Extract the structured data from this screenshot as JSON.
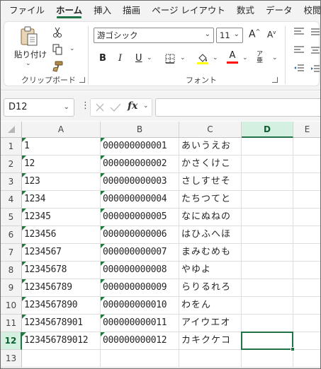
{
  "menu": {
    "tabs": [
      "ファイル",
      "ホーム",
      "挿入",
      "描画",
      "ページ レイアウト",
      "数式",
      "データ",
      "校閲"
    ],
    "active_index": 1
  },
  "ribbon": {
    "clipboard": {
      "group_label": "クリップボード",
      "paste_label": "貼り付け"
    },
    "font": {
      "group_label": "フォント",
      "font_name": "游ゴシック",
      "font_size": "11",
      "increase_label": "A",
      "decrease_label": "A",
      "bold_label": "B",
      "italic_label": "I",
      "underline_label": "U",
      "font_color_label": "A",
      "phonetic_label": "ア亜",
      "fill_color": "#ffff00",
      "font_color": "#ff0000"
    }
  },
  "formula_bar": {
    "name_box": "D12",
    "fx_label": "fx",
    "formula": ""
  },
  "sheet": {
    "columns": [
      "A",
      "B",
      "C",
      "D",
      "E"
    ],
    "selected_column": "D",
    "selected_row": 12,
    "rows": [
      {
        "num": "1",
        "a": "1",
        "b": "000000000001",
        "c": "あいうえお"
      },
      {
        "num": "2",
        "a": "12",
        "b": "000000000002",
        "c": "かさくけこ"
      },
      {
        "num": "3",
        "a": "123",
        "b": "000000000003",
        "c": "さしすせそ"
      },
      {
        "num": "4",
        "a": "1234",
        "b": "000000000004",
        "c": "たちつてと"
      },
      {
        "num": "5",
        "a": "12345",
        "b": "000000000005",
        "c": "なにぬねの"
      },
      {
        "num": "6",
        "a": "123456",
        "b": "000000000006",
        "c": "はひふへほ"
      },
      {
        "num": "7",
        "a": "1234567",
        "b": "000000000007",
        "c": "まみむめも"
      },
      {
        "num": "8",
        "a": "12345678",
        "b": "000000000008",
        "c": "やゆよ"
      },
      {
        "num": "9",
        "a": "123456789",
        "b": "000000000009",
        "c": "らりるれろ"
      },
      {
        "num": "10",
        "a": "1234567890",
        "b": "000000000010",
        "c": "わをん"
      },
      {
        "num": "11",
        "a": "12345678901",
        "b": "000000000011",
        "c": "アイウエオ"
      },
      {
        "num": "12",
        "a": "123456789012",
        "b": "000000000012",
        "c": "カキクケコ"
      },
      {
        "num": "13",
        "a": "",
        "b": "",
        "c": ""
      }
    ]
  },
  "colors": {
    "accent": "#217346",
    "error_triangle": "#1e7a3c"
  }
}
